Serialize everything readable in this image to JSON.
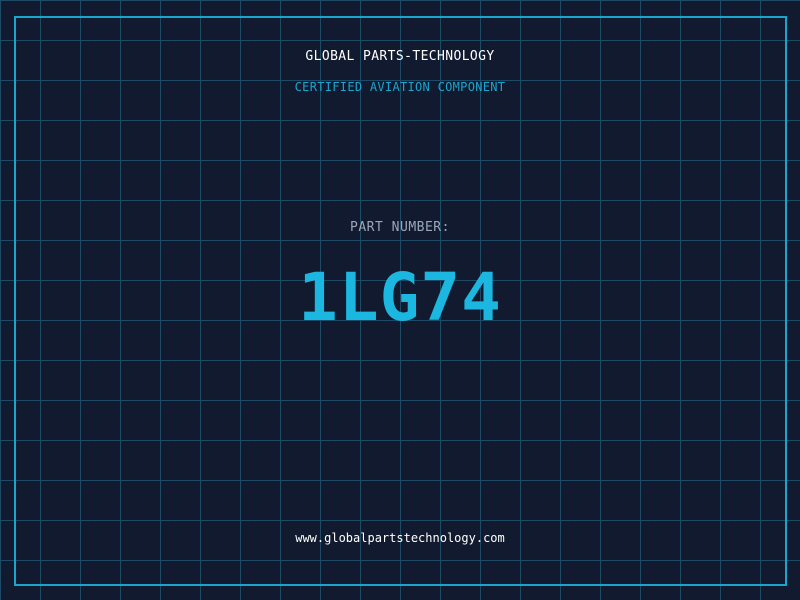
{
  "header": {
    "company": "GLOBAL PARTS-TECHNOLOGY",
    "subtitle": "CERTIFIED AVIATION COMPONENT"
  },
  "part": {
    "label": "PART NUMBER:",
    "number": "1LG74"
  },
  "footer": {
    "website": "www.globalpartstechnology.com"
  },
  "colors": {
    "background": "#111a2e",
    "grid": "#1d4a66",
    "accent": "#1aa5cf",
    "part_number": "#1bb7e0",
    "label": "#9aa8ba",
    "text": "#ffffff"
  }
}
